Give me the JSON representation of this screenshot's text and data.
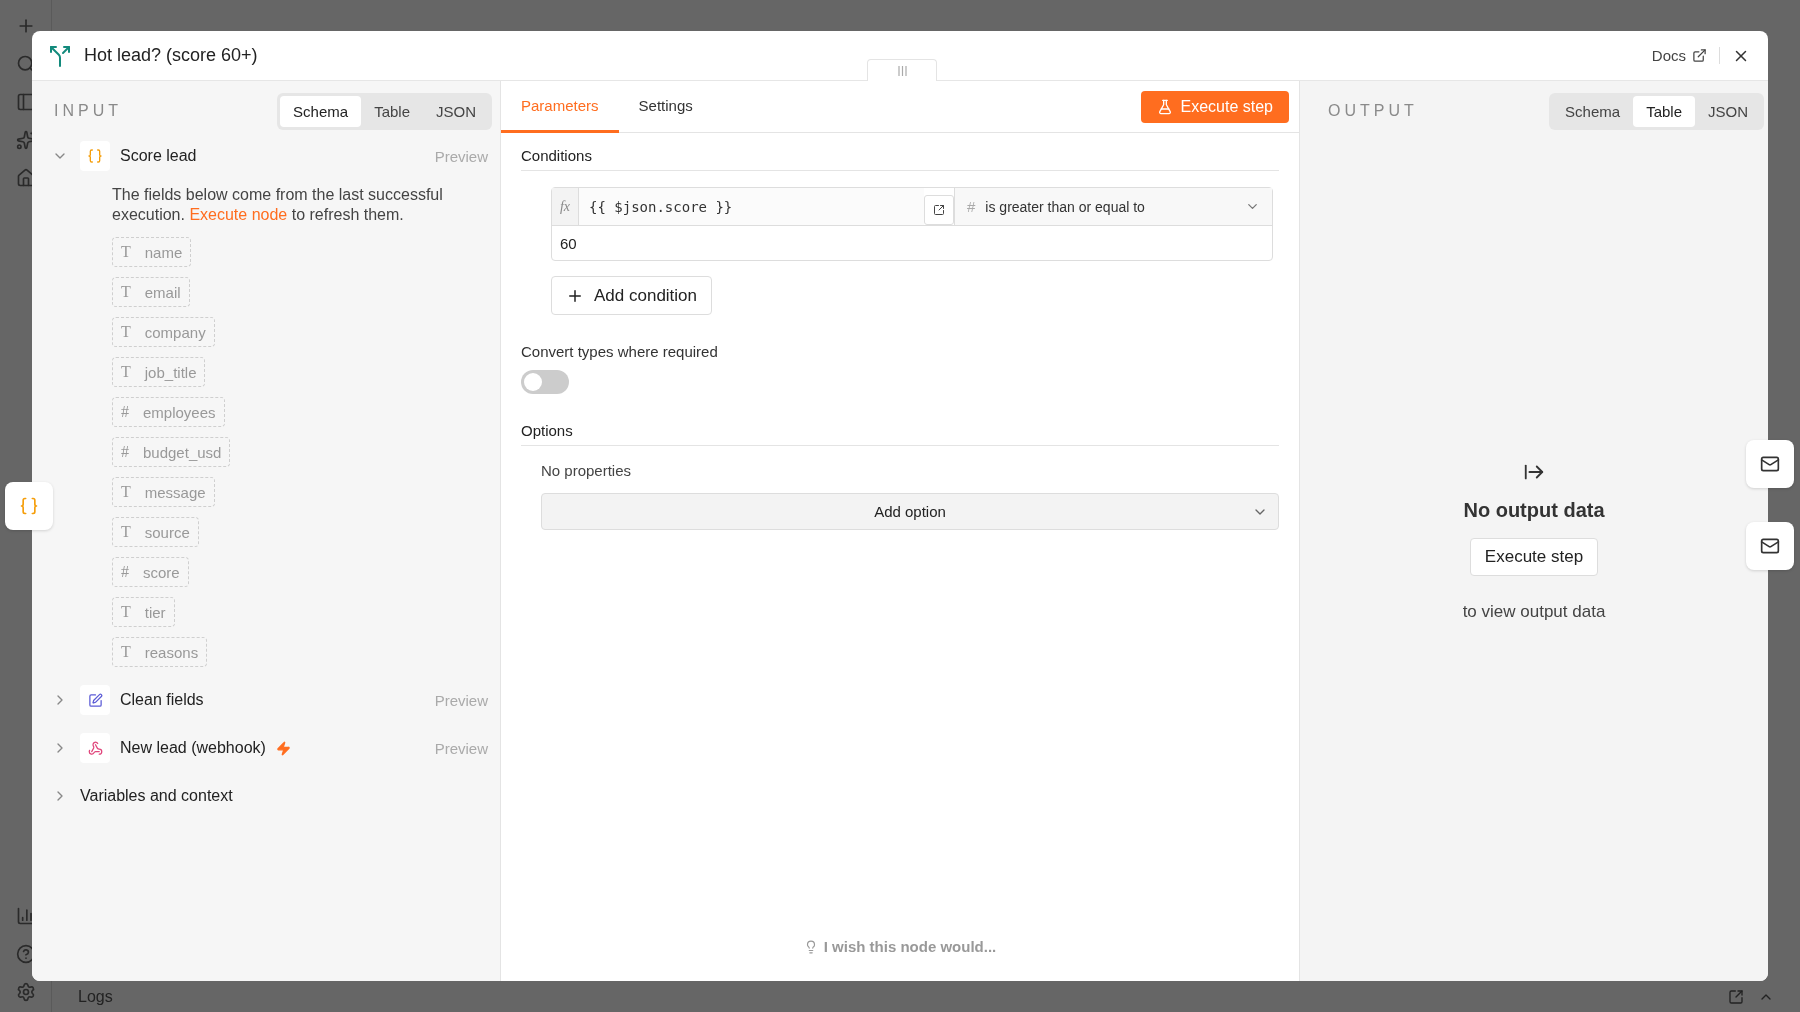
{
  "bottom_bar": {
    "label": "Logs"
  },
  "modal": {
    "title": "Hot lead? (score 60+)",
    "docs_link": "Docs"
  },
  "input_panel": {
    "heading": "INPUT",
    "view_tabs": [
      {
        "label": "Schema",
        "selected": true
      },
      {
        "label": "Table",
        "selected": false
      },
      {
        "label": "JSON",
        "selected": false
      }
    ],
    "nodes": [
      {
        "name": "Score lead",
        "kind": "code",
        "expanded": true,
        "trigger": false,
        "preview": "Preview",
        "notice": {
          "before": "The fields below come from the last successful execution.",
          "link": "Execute node",
          "after": "to refresh them."
        },
        "fields": [
          {
            "glyph": "T",
            "name": "name"
          },
          {
            "glyph": "T",
            "name": "email"
          },
          {
            "glyph": "T",
            "name": "company"
          },
          {
            "glyph": "T",
            "name": "job_title"
          },
          {
            "glyph": "#",
            "name": "employees"
          },
          {
            "glyph": "#",
            "name": "budget_usd"
          },
          {
            "glyph": "T",
            "name": "message"
          },
          {
            "glyph": "T",
            "name": "source"
          },
          {
            "glyph": "#",
            "name": "score"
          },
          {
            "glyph": "T",
            "name": "tier"
          },
          {
            "glyph": "T",
            "name": "reasons"
          }
        ]
      },
      {
        "name": "Clean fields",
        "kind": "edit",
        "expanded": false,
        "trigger": false,
        "preview": "Preview"
      },
      {
        "name": "New lead (webhook)",
        "kind": "webhook",
        "expanded": false,
        "trigger": true,
        "preview": "Preview"
      }
    ],
    "variables": {
      "label": "Variables and context",
      "expanded": false
    }
  },
  "parameters_panel": {
    "tabs": [
      {
        "label": "Parameters",
        "selected": true
      },
      {
        "label": "Settings",
        "selected": false
      }
    ],
    "execute_button": "Execute step",
    "conditions": {
      "heading": "Conditions",
      "expression_badge": "fx",
      "left_value": "{{ $json.score }}",
      "operator_glyph": "#",
      "operator": "is greater than or equal to",
      "right_value": "60",
      "add_button": "Add condition"
    },
    "convert_types": {
      "label": "Convert types where required",
      "on": false
    },
    "options": {
      "heading": "Options",
      "empty_text": "No properties",
      "add_button": "Add option"
    },
    "feedback": "I wish this node would..."
  },
  "output_panel": {
    "heading": "OUTPUT",
    "view_tabs": [
      {
        "label": "Schema",
        "selected": false
      },
      {
        "label": "Table",
        "selected": true
      },
      {
        "label": "JSON",
        "selected": false
      }
    ],
    "empty_title": "No output data",
    "execute_button": "Execute step",
    "empty_hint": "to view output data"
  }
}
